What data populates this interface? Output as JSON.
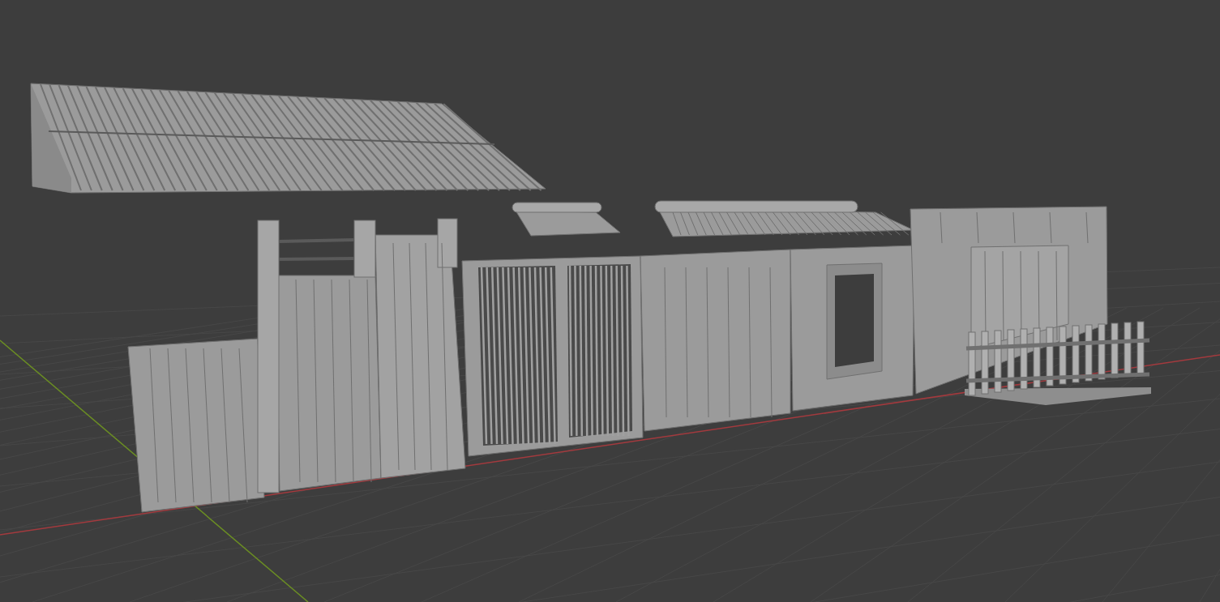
{
  "viewport": {
    "grid": true,
    "axes": [
      {
        "kind": "x",
        "color": "#a33a3e"
      },
      {
        "kind": "y",
        "color": "#6b8e23"
      }
    ],
    "objects": [
      {
        "kind": "tiled-roof"
      },
      {
        "kind": "roof-section"
      },
      {
        "kind": "tiled-awning"
      },
      {
        "kind": "plank-panel"
      },
      {
        "kind": "gate"
      },
      {
        "kind": "barred-door"
      },
      {
        "kind": "plank-wall"
      },
      {
        "kind": "window-wall"
      },
      {
        "kind": "doorway-wall"
      },
      {
        "kind": "picket-fence"
      }
    ]
  }
}
